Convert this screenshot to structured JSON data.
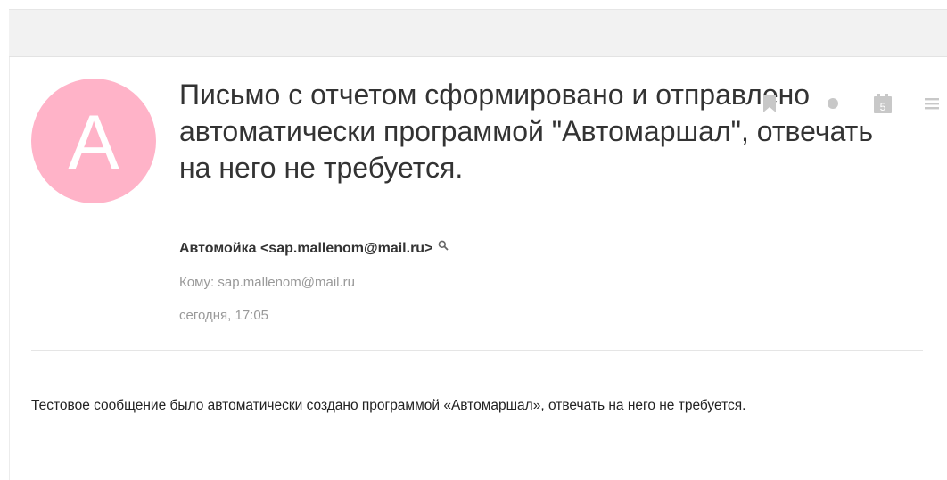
{
  "message": {
    "avatar_letter": "A",
    "subject": "Письмо с отчетом сформировано и отправлено автоматически программой \"Автомаршал\", отвечать на него не требуется.",
    "sender": "Автомойка <sap.mallenom@mail.ru>",
    "recipient_line": "Кому: sap.mallenom@mail.ru",
    "date": "сегодня, 17:05",
    "body": "Тестовое сообщение было автоматически создано программой «Автомаршал», отвечать на него не требуется."
  },
  "actions": {
    "calendar_day": "5",
    "icons": [
      "bookmark-icon",
      "dot-icon",
      "calendar-icon",
      "menu-icon",
      "search-icon"
    ]
  },
  "colors": {
    "avatar": "#ffb3c8",
    "toolbar": "#f2f2f2",
    "icon": "#c8c8c8",
    "text_primary": "#333333",
    "text_secondary": "#999999"
  }
}
